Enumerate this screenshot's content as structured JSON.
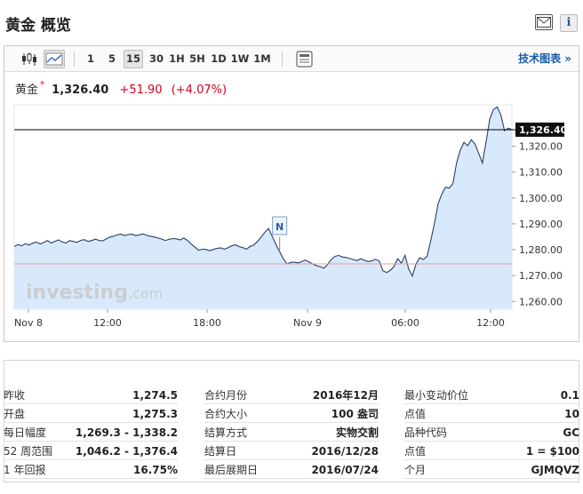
{
  "header": {
    "title": "黄金 概览"
  },
  "toolbar": {
    "intervals": [
      "1",
      "5",
      "15",
      "30",
      "1H",
      "5H",
      "1D",
      "1W",
      "1M"
    ],
    "active_interval": "15",
    "tech_chart_link": "技术图表 »"
  },
  "quote": {
    "name": "黄金",
    "star": "*",
    "price": "1,326.40",
    "change": "+51.90",
    "change_pct": "(+4.07%)"
  },
  "watermark": {
    "brand": "investing",
    "suffix": ".com"
  },
  "colors": {
    "up": "#d0021b",
    "area_fill": "#d8e9fb",
    "line": "#2c3e66",
    "reference_line": "#e0a0a0",
    "link": "#1a5aa6"
  },
  "chart_data": {
    "type": "area",
    "x_labels": [
      "Nov 8",
      "12:00",
      "18:00",
      "Nov 9",
      "06:00",
      "12:00"
    ],
    "y_ticks": [
      "1,320.00",
      "1,310.00",
      "1,300.00",
      "1,290.00",
      "1,280.00",
      "1,270.00",
      "1,260.00"
    ],
    "ylim": [
      1257,
      1336
    ],
    "current_price_label": "1,326.40",
    "current_price": 1326.4,
    "previous_close": 1274.5,
    "annotation": "N",
    "annotation_x": 72,
    "values": [
      1281.2,
      1282.0,
      1281.5,
      1282.3,
      1281.8,
      1282.5,
      1283.0,
      1282.2,
      1282.8,
      1283.5,
      1282.6,
      1283.2,
      1283.8,
      1283.0,
      1282.6,
      1283.5,
      1283.2,
      1282.8,
      1283.6,
      1283.9,
      1283.2,
      1283.5,
      1284.1,
      1283.6,
      1283.4,
      1284.2,
      1284.9,
      1285.2,
      1285.8,
      1286.0,
      1285.5,
      1285.9,
      1286.0,
      1285.4,
      1285.8,
      1286.1,
      1285.5,
      1285.2,
      1284.9,
      1284.5,
      1284.1,
      1283.6,
      1284.0,
      1284.3,
      1284.2,
      1283.8,
      1284.5,
      1283.6,
      1282.2,
      1281.0,
      1279.8,
      1280.2,
      1280.1,
      1279.6,
      1280.1,
      1280.5,
      1280.7,
      1280.2,
      1280.8,
      1281.5,
      1281.9,
      1281.2,
      1280.8,
      1280.2,
      1281.3,
      1281.8,
      1283.2,
      1284.9,
      1286.8,
      1288.2,
      1285.1,
      1282.0,
      1279.2,
      1276.5,
      1274.5,
      1275.1,
      1275.2,
      1274.9,
      1275.4,
      1276.0,
      1275.2,
      1274.5,
      1273.8,
      1273.5,
      1272.8,
      1274.3,
      1276.2,
      1277.4,
      1277.8,
      1277.2,
      1277.0,
      1276.6,
      1276.2,
      1275.8,
      1276.5,
      1275.9,
      1275.4,
      1275.7,
      1276.3,
      1275.6,
      1271.9,
      1271.2,
      1272.0,
      1273.5,
      1276.5,
      1274.8,
      1277.8,
      1272.5,
      1269.8,
      1274.5,
      1276.9,
      1276.2,
      1277.5,
      1283.5,
      1290.2,
      1297.8,
      1301.5,
      1304.2,
      1303.8,
      1305.5,
      1313.6,
      1318.5,
      1321.5,
      1320.2,
      1322.5,
      1320.8,
      1317.2,
      1313.5,
      1321.8,
      1330.5,
      1334.2,
      1335.2,
      1332.0,
      1326.0,
      1327.0,
      1326.4
    ]
  },
  "stats": {
    "col1": [
      {
        "label": "昨收",
        "value": "1,274.5"
      },
      {
        "label": "开盘",
        "value": "1,275.3"
      },
      {
        "label": "每日幅度",
        "value": "1,269.3 - 1,338.2"
      },
      {
        "label": "52 周范围",
        "value": "1,046.2 - 1,376.4"
      },
      {
        "label": "1 年回报",
        "value": "16.75%"
      }
    ],
    "col2": [
      {
        "label": "合约月份",
        "value": "2016年12月"
      },
      {
        "label": "合约大小",
        "value": "100 盎司"
      },
      {
        "label": "结算方式",
        "value": "实物交割"
      },
      {
        "label": "结算日",
        "value": "2016/12/28"
      },
      {
        "label": "最后展期日",
        "value": "2016/07/24"
      }
    ],
    "col3": [
      {
        "label": "最小变动价位",
        "value": "0.1"
      },
      {
        "label": "点值",
        "value": "10"
      },
      {
        "label": "品种代码",
        "value": "GC"
      },
      {
        "label": "点值",
        "value": "1 = $100"
      },
      {
        "label": "个月",
        "value": "GJMQVZ"
      }
    ]
  }
}
